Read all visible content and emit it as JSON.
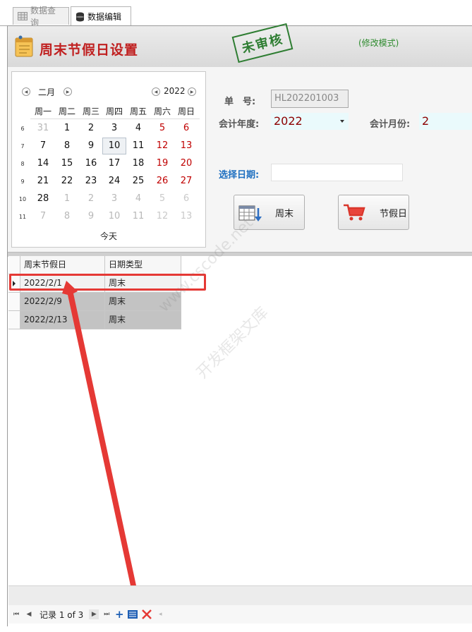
{
  "tabs": [
    {
      "label": "数据查询",
      "icon": "grid-icon",
      "active": false
    },
    {
      "label": "数据编辑",
      "icon": "database-icon",
      "active": true
    }
  ],
  "header": {
    "title": "周末节假日设置",
    "stamp": "未审核",
    "mode": "(修改模式)"
  },
  "calendar": {
    "month": "二月",
    "year": "2022",
    "weekdays": [
      "周一",
      "周二",
      "周三",
      "周四",
      "周五",
      "周六",
      "周日"
    ],
    "weeks": [
      {
        "num": "6",
        "days": [
          "31",
          "1",
          "2",
          "3",
          "4",
          "5",
          "6"
        ]
      },
      {
        "num": "7",
        "days": [
          "7",
          "8",
          "9",
          "10",
          "11",
          "12",
          "13"
        ]
      },
      {
        "num": "8",
        "days": [
          "14",
          "15",
          "16",
          "17",
          "18",
          "19",
          "20"
        ]
      },
      {
        "num": "9",
        "days": [
          "21",
          "22",
          "23",
          "24",
          "25",
          "26",
          "27"
        ]
      },
      {
        "num": "10",
        "days": [
          "28",
          "1",
          "2",
          "3",
          "4",
          "5",
          "6"
        ]
      },
      {
        "num": "11",
        "days": [
          "7",
          "8",
          "9",
          "10",
          "11",
          "12",
          "13"
        ]
      }
    ],
    "today_label": "今天",
    "selected_day": "10"
  },
  "form": {
    "doc_no_label": "单　号:",
    "doc_no_value": "HL202201003",
    "year_label": "会计年度:",
    "year_value": "2022",
    "month_label": "会计月份:",
    "month_value": "2",
    "date_label": "选择日期:",
    "date_value": ""
  },
  "buttons": {
    "weekend": "周末",
    "holiday": "节假日"
  },
  "grid": {
    "columns": [
      "周末节假日",
      "日期类型"
    ],
    "rows": [
      [
        "2022/2/1",
        "周末"
      ],
      [
        "2022/2/9",
        "周末"
      ],
      [
        "2022/2/13",
        "周末"
      ]
    ]
  },
  "navigator": {
    "record_text": "记录 1 of 3"
  },
  "watermark": {
    "line1": "www.cscode.net",
    "line2": "开发框架文库"
  },
  "colors": {
    "title_red": "#c02020",
    "stamp_green": "#2e7d32",
    "mode_green": "#2e8b2e",
    "highlight_red": "#e53935",
    "weekend_red": "#c00000"
  }
}
